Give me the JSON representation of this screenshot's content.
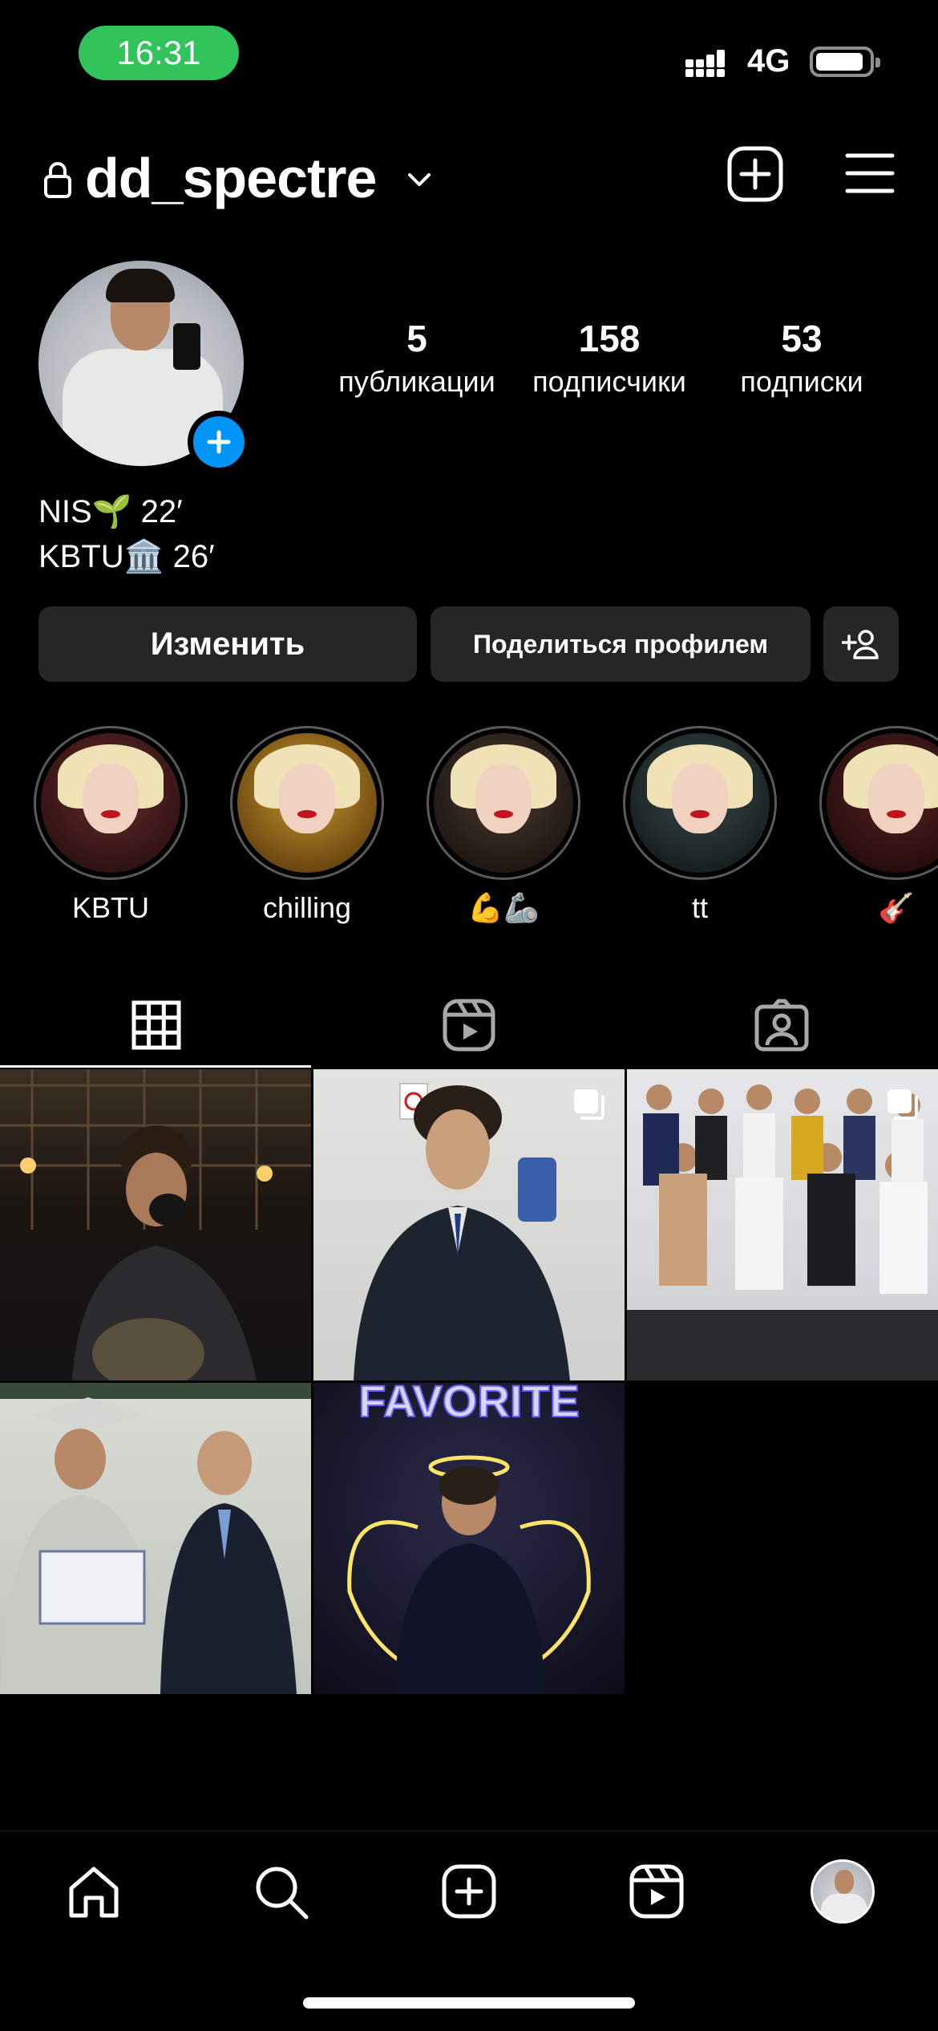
{
  "status_bar": {
    "time": "16:31",
    "network": "4G"
  },
  "header": {
    "username": "dd_spectre"
  },
  "profile": {
    "stats": [
      {
        "value": "5",
        "label": "публикации"
      },
      {
        "value": "158",
        "label": "подписчики"
      },
      {
        "value": "53",
        "label": "подписки"
      }
    ],
    "bio_lines": [
      "NIS🌱 22′",
      "KBTU🏛️ 26′"
    ]
  },
  "buttons": {
    "edit": "Изменить",
    "share": "Поделиться профилем"
  },
  "highlights": [
    {
      "label": "KBTU"
    },
    {
      "label": "chilling"
    },
    {
      "label": "💪🦾"
    },
    {
      "label": "tt"
    },
    {
      "label": "🎸"
    }
  ],
  "tabs": [
    "grid-icon",
    "reels-icon",
    "tagged-icon"
  ],
  "posts": [
    {
      "description": "cafe",
      "multiple": false
    },
    {
      "description": "selfie",
      "multiple": true
    },
    {
      "description": "group",
      "multiple": true
    },
    {
      "description": "graduation",
      "multiple": false
    },
    {
      "description": "favorite",
      "multiple": false,
      "sign": "FAVORITE"
    }
  ],
  "bottom_nav": [
    "home-icon",
    "search-icon",
    "new-post-icon",
    "reels-icon",
    "profile-avatar"
  ]
}
